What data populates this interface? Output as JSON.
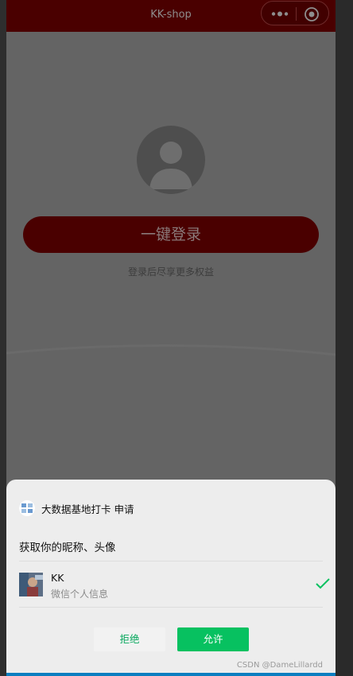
{
  "navbar": {
    "title": "KK-shop"
  },
  "login": {
    "button_label": "一键登录",
    "hint": "登录后尽享更多权益"
  },
  "auth_sheet": {
    "app_name": "大数据基地打卡 申请",
    "scope_text": "获取你的昵称、头像",
    "user": {
      "name": "KK",
      "subtitle": "微信个人信息"
    },
    "reject_label": "拒绝",
    "allow_label": "允许"
  },
  "watermark": "CSDN @DameLillardd",
  "colors": {
    "navbar": "#4a0000",
    "overlay": "#646464",
    "allow": "#07c160",
    "check": "#07c160"
  }
}
